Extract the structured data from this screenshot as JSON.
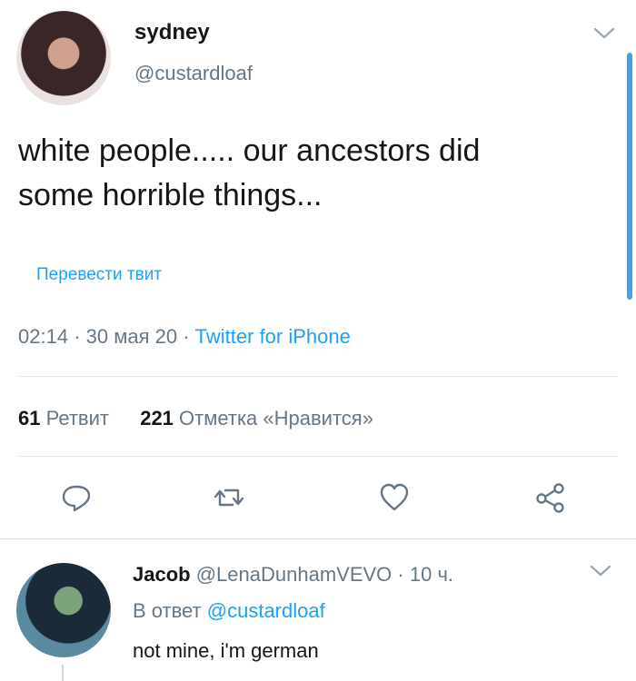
{
  "colors": {
    "accent": "#1da1f2",
    "text": "#14171a",
    "muted": "#657786",
    "divider": "#e1e8ed"
  },
  "tweet": {
    "author_name": "sydney",
    "author_handle": "@custardloaf",
    "text_line1": "white people..... our ancestors did",
    "text_line2": "some horrible things...",
    "translate_label": "Перевести твит",
    "time": "02:14",
    "date": "30 мая 20",
    "source": "Twitter for iPhone",
    "retweets_count": "61",
    "retweets_label": "Ретвит",
    "likes_count": "221",
    "likes_label": "Отметка «Нравится»",
    "actions": {
      "reply_icon": "reply-icon",
      "retweet_icon": "retweet-icon",
      "like_icon": "heart-icon",
      "share_icon": "share-icon"
    }
  },
  "reply": {
    "author_name": "Jacob",
    "author_handle": "@LenaDunhamVEVO",
    "time": "10 ч.",
    "in_reply_prefix": "В ответ",
    "in_reply_mention": "@custardloaf",
    "text": "not mine, i'm german"
  }
}
